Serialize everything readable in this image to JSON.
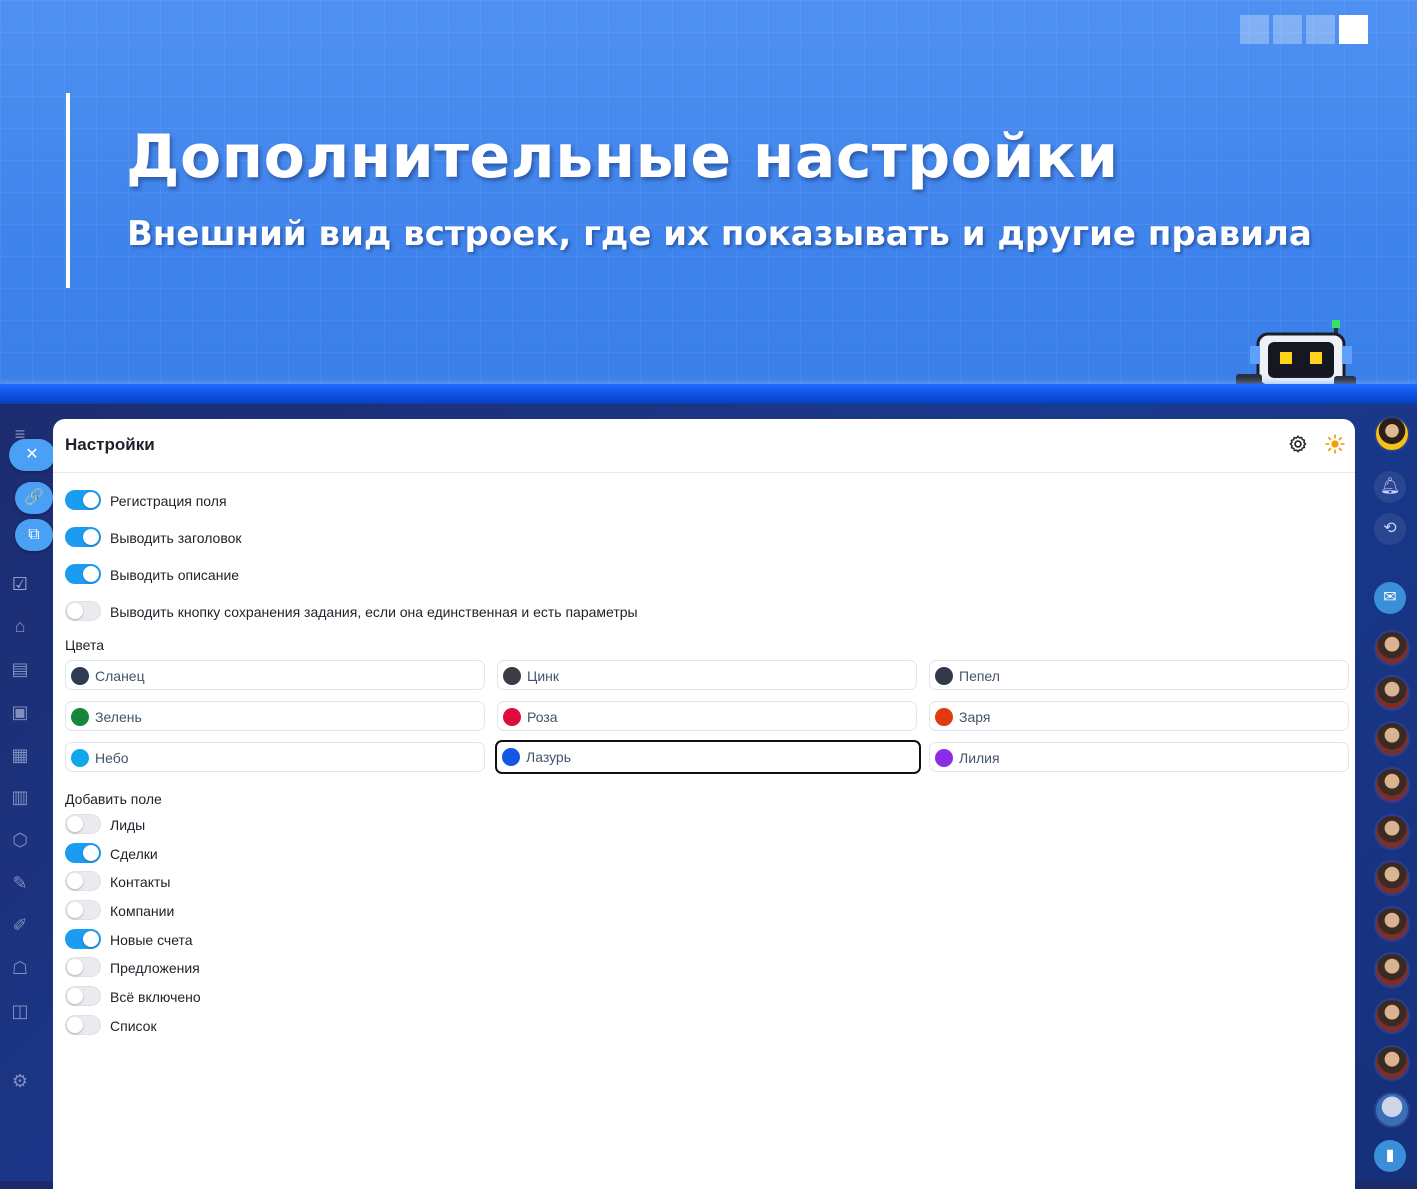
{
  "banner": {
    "title": "Дополнительные настройки",
    "subtitle": "Внешний вид встроек, где их показывать и другие правила"
  },
  "panel": {
    "title": "Настройки",
    "header_icons": [
      "gear-icon",
      "sun-icon"
    ]
  },
  "options": [
    {
      "label": "Регистрация поля",
      "on": true
    },
    {
      "label": "Выводить заголовок",
      "on": true
    },
    {
      "label": "Выводить описание",
      "on": true
    },
    {
      "label": "Выводить кнопку сохранения задания, если она единственная и есть параметры",
      "on": false
    }
  ],
  "colors": {
    "label": "Цвета",
    "selected": "Лазурь",
    "items": [
      {
        "name": "Сланец",
        "hex": "#2f3b52"
      },
      {
        "name": "Цинк",
        "hex": "#3a3d44"
      },
      {
        "name": "Пепел",
        "hex": "#34394a"
      },
      {
        "name": "Зелень",
        "hex": "#16873a"
      },
      {
        "name": "Роза",
        "hex": "#dc0d3e"
      },
      {
        "name": "Заря",
        "hex": "#e03b10"
      },
      {
        "name": "Небо",
        "hex": "#12a6ea"
      },
      {
        "name": "Лазурь",
        "hex": "#1457e6"
      },
      {
        "name": "Лилия",
        "hex": "#8a2ce8"
      }
    ]
  },
  "add_field": {
    "label": "Добавить поле",
    "items": [
      {
        "label": "Лиды",
        "on": false
      },
      {
        "label": "Сделки",
        "on": true
      },
      {
        "label": "Контакты",
        "on": false
      },
      {
        "label": "Компании",
        "on": false
      },
      {
        "label": "Новые счета",
        "on": true
      },
      {
        "label": "Предложения",
        "on": false
      },
      {
        "label": "Всё включено",
        "on": false
      },
      {
        "label": "Список",
        "on": false
      }
    ]
  },
  "accent_color": "#1c9cf0"
}
